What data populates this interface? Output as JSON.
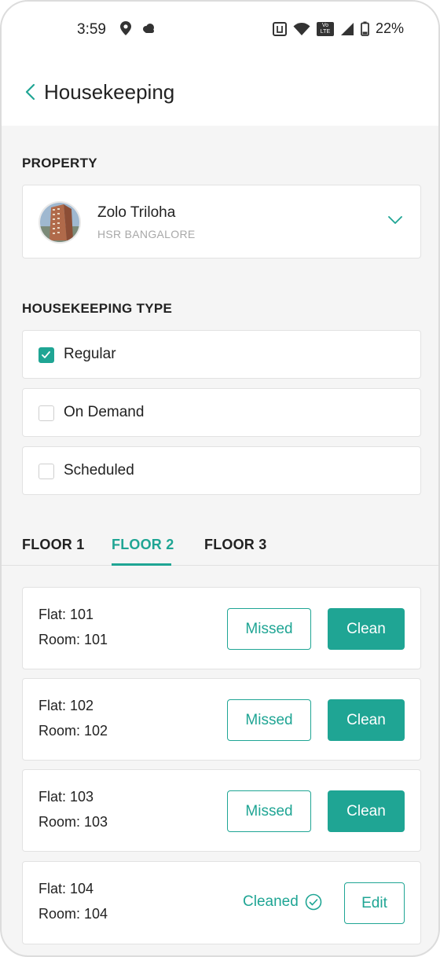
{
  "status_bar": {
    "time": "3:59",
    "battery": "22%",
    "volte_label": "Vo LTE"
  },
  "header": {
    "title": "Housekeeping"
  },
  "property_section": {
    "label": "PROPERTY",
    "name": "Zolo Triloha",
    "location": "HSR BANGALORE"
  },
  "type_section": {
    "label": "HOUSEKEEPING TYPE",
    "options": [
      {
        "label": "Regular",
        "checked": true
      },
      {
        "label": "On Demand",
        "checked": false
      },
      {
        "label": "Scheduled",
        "checked": false
      }
    ]
  },
  "floor_tabs": {
    "tabs": [
      "FLOOR 1",
      "FLOOR 2",
      "FLOOR 3"
    ],
    "active": "FLOOR 2"
  },
  "rooms": [
    {
      "flat": "Flat: 101",
      "room": "Room: 101",
      "missed_label": "Missed",
      "clean_label": "Clean"
    },
    {
      "flat": "Flat: 102",
      "room": "Room: 102",
      "missed_label": "Missed",
      "clean_label": "Clean"
    },
    {
      "flat": "Flat: 103",
      "room": "Room: 103",
      "missed_label": "Missed",
      "clean_label": "Clean"
    },
    {
      "flat": "Flat: 104",
      "room": "Room: 104",
      "status_label": "Cleaned",
      "edit_label": "Edit"
    }
  ],
  "colors": {
    "accent": "#1fa594",
    "background": "#f5f5f5",
    "card": "#ffffff"
  }
}
